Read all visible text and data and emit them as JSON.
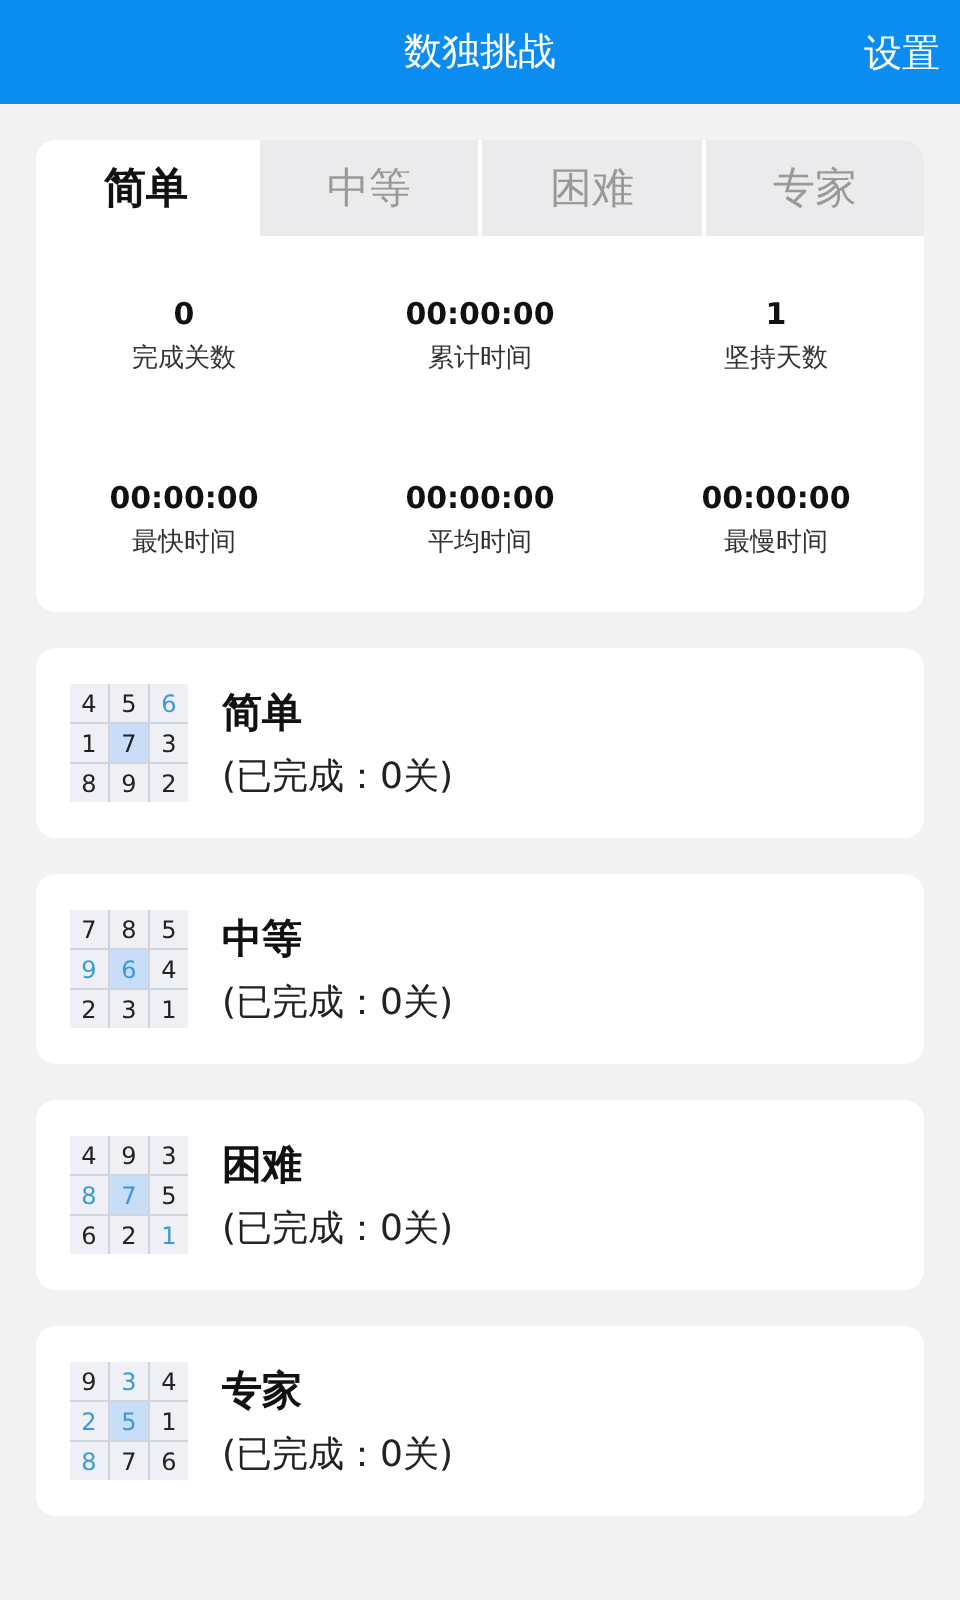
{
  "header": {
    "title": "数独挑战",
    "action": "设置"
  },
  "tabs": [
    {
      "label": "简单",
      "selected": true
    },
    {
      "label": "中等",
      "selected": false
    },
    {
      "label": "困难",
      "selected": false
    },
    {
      "label": "专家",
      "selected": false
    }
  ],
  "stats": [
    {
      "value": "0",
      "label": "完成关数"
    },
    {
      "value": "00:00:00",
      "label": "累计时间"
    },
    {
      "value": "1",
      "label": "坚持天数"
    },
    {
      "value": "00:00:00",
      "label": "最快时间"
    },
    {
      "value": "00:00:00",
      "label": "平均时间"
    },
    {
      "value": "00:00:00",
      "label": "最慢时间"
    }
  ],
  "levels": [
    {
      "title": "简单",
      "progress": "(已完成：0关)",
      "grid": [
        {
          "digit": "4",
          "kind": "given",
          "selected": false
        },
        {
          "digit": "5",
          "kind": "given",
          "selected": false
        },
        {
          "digit": "6",
          "kind": "entered",
          "selected": false
        },
        {
          "digit": "1",
          "kind": "given",
          "selected": false
        },
        {
          "digit": "7",
          "kind": "given",
          "selected": true
        },
        {
          "digit": "3",
          "kind": "given",
          "selected": false
        },
        {
          "digit": "8",
          "kind": "given",
          "selected": false
        },
        {
          "digit": "9",
          "kind": "given",
          "selected": false
        },
        {
          "digit": "2",
          "kind": "given",
          "selected": false
        }
      ]
    },
    {
      "title": "中等",
      "progress": "(已完成：0关)",
      "grid": [
        {
          "digit": "7",
          "kind": "given",
          "selected": false
        },
        {
          "digit": "8",
          "kind": "given",
          "selected": false
        },
        {
          "digit": "5",
          "kind": "given",
          "selected": false
        },
        {
          "digit": "9",
          "kind": "entered",
          "selected": false
        },
        {
          "digit": "6",
          "kind": "entered",
          "selected": true
        },
        {
          "digit": "4",
          "kind": "given",
          "selected": false
        },
        {
          "digit": "2",
          "kind": "given",
          "selected": false
        },
        {
          "digit": "3",
          "kind": "given",
          "selected": false
        },
        {
          "digit": "1",
          "kind": "given",
          "selected": false
        }
      ]
    },
    {
      "title": "困难",
      "progress": "(已完成：0关)",
      "grid": [
        {
          "digit": "4",
          "kind": "given",
          "selected": false
        },
        {
          "digit": "9",
          "kind": "given",
          "selected": false
        },
        {
          "digit": "3",
          "kind": "given",
          "selected": false
        },
        {
          "digit": "8",
          "kind": "entered",
          "selected": false
        },
        {
          "digit": "7",
          "kind": "entered",
          "selected": true
        },
        {
          "digit": "5",
          "kind": "given",
          "selected": false
        },
        {
          "digit": "6",
          "kind": "given",
          "selected": false
        },
        {
          "digit": "2",
          "kind": "given",
          "selected": false
        },
        {
          "digit": "1",
          "kind": "entered",
          "selected": false
        }
      ]
    },
    {
      "title": "专家",
      "progress": "(已完成：0关)",
      "grid": [
        {
          "digit": "9",
          "kind": "given",
          "selected": false
        },
        {
          "digit": "3",
          "kind": "entered",
          "selected": false
        },
        {
          "digit": "4",
          "kind": "given",
          "selected": false
        },
        {
          "digit": "2",
          "kind": "entered",
          "selected": false
        },
        {
          "digit": "5",
          "kind": "entered",
          "selected": true
        },
        {
          "digit": "1",
          "kind": "given",
          "selected": false
        },
        {
          "digit": "8",
          "kind": "entered",
          "selected": false
        },
        {
          "digit": "7",
          "kind": "given",
          "selected": false
        },
        {
          "digit": "6",
          "kind": "given",
          "selected": false
        }
      ]
    }
  ]
}
